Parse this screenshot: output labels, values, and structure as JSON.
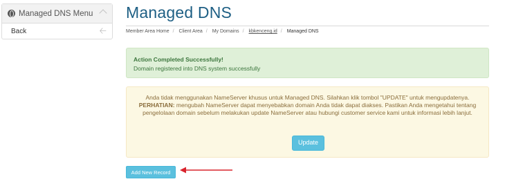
{
  "sidebar": {
    "title": "Managed DNS Menu",
    "items": [
      {
        "label": "Back",
        "icon": "arrow-left-icon"
      }
    ]
  },
  "header": {
    "title": "Managed DNS"
  },
  "breadcrumb": [
    "Member Area Home",
    "Client Area",
    "My Domains",
    "kbkenceng.id",
    "Managed DNS"
  ],
  "success_alert": {
    "heading": "Action Completed Successfully!",
    "message": "Domain registered into DNS system successfully"
  },
  "warning_alert": {
    "line1": "Anda tidak menggunakan NameServer khusus untuk Managed DNS. Silahkan klik tombol \"UPDATE\" untuk mengupdatenya.",
    "strong_label": "PERHATIAN:",
    "line2": " mengubah NameServer dapat menyebabkan domain Anda tidak dapat diakses. Pastikan Anda mengetahui tentang pengelolaan domain sebelum melakukan update NameServer atau hubungi customer service kami untuk informasi lebih lanjut.",
    "update_label": "Update"
  },
  "actions": {
    "add_record_label": "Add New Record"
  },
  "colors": {
    "title": "#1e5f84",
    "success_bg": "#dff0d8",
    "warning_bg": "#fcf8e3",
    "info_button": "#5bc0de",
    "annotation": "#d9232d"
  }
}
